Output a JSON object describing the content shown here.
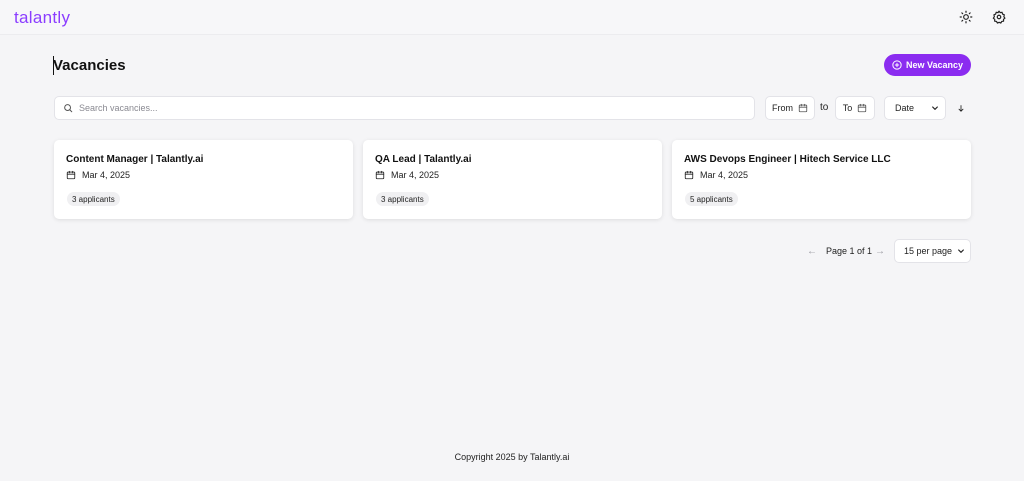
{
  "app": {
    "logo": "talantly"
  },
  "header": {
    "theme_icon": "sun-icon",
    "settings_icon": "gear-icon"
  },
  "page": {
    "title": "Vacancies",
    "new_button_label": "New Vacancy"
  },
  "filters": {
    "search_placeholder": "Search vacancies...",
    "from_label": "From",
    "to_separator": "to",
    "to_label": "To",
    "sort_value": "Date"
  },
  "vacancies": [
    {
      "title": "Content Manager | Talantly.ai",
      "date": "Mar 4, 2025",
      "applicants": "3 applicants"
    },
    {
      "title": "QA Lead | Talantly.ai",
      "date": "Mar 4, 2025",
      "applicants": "3 applicants"
    },
    {
      "title": "AWS Devops Engineer | Hitech Service LLC",
      "date": "Mar 4, 2025",
      "applicants": "5 applicants"
    }
  ],
  "pagination": {
    "prev": "←",
    "label": "Page 1 of 1",
    "next": "→",
    "per_page": "15 per page"
  },
  "footer": {
    "copyright": "Copyright 2025 by Talantly.ai"
  },
  "colors": {
    "accent": "#8b2cf0",
    "logo": "#8b3dff",
    "background": "#f5f5f7"
  }
}
